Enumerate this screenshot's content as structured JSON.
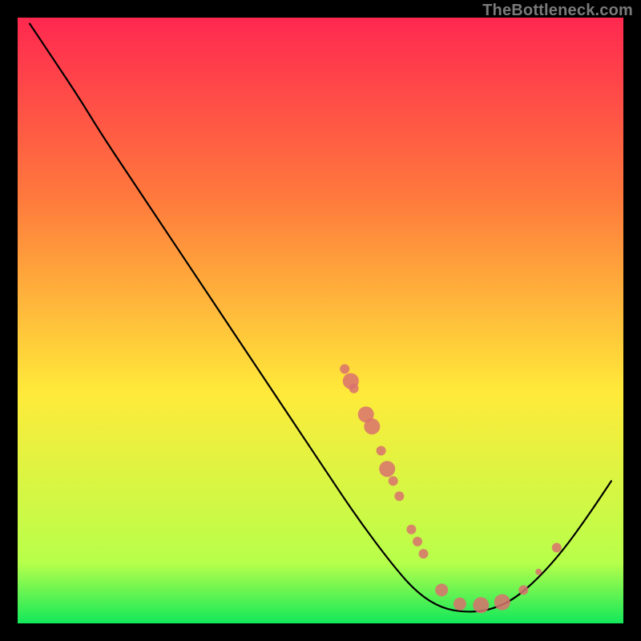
{
  "watermark": "TheBottleneck.com",
  "chart_data": {
    "type": "line",
    "title": "",
    "xlabel": "",
    "ylabel": "",
    "xlim": [
      0,
      100
    ],
    "ylim": [
      0,
      100
    ],
    "grid": false,
    "legend": false,
    "background_gradient": {
      "top": "#ff2850",
      "mid": "#ffea3a",
      "bottom": "#12e85a"
    },
    "series": [
      {
        "name": "curve",
        "type": "line",
        "color": "#000000",
        "points": [
          {
            "x": 2.0,
            "y": 99.0
          },
          {
            "x": 6.0,
            "y": 93.0
          },
          {
            "x": 10.0,
            "y": 87.0
          },
          {
            "x": 14.0,
            "y": 80.5
          },
          {
            "x": 20.0,
            "y": 71.5
          },
          {
            "x": 30.0,
            "y": 56.5
          },
          {
            "x": 40.0,
            "y": 41.5
          },
          {
            "x": 50.0,
            "y": 26.5
          },
          {
            "x": 56.0,
            "y": 17.5
          },
          {
            "x": 62.0,
            "y": 9.5
          },
          {
            "x": 66.0,
            "y": 5.0
          },
          {
            "x": 70.0,
            "y": 2.5
          },
          {
            "x": 74.0,
            "y": 1.8
          },
          {
            "x": 78.0,
            "y": 2.2
          },
          {
            "x": 82.0,
            "y": 4.0
          },
          {
            "x": 86.0,
            "y": 7.5
          },
          {
            "x": 90.0,
            "y": 12.0
          },
          {
            "x": 94.0,
            "y": 17.5
          },
          {
            "x": 98.0,
            "y": 23.5
          }
        ]
      },
      {
        "name": "markers",
        "type": "scatter",
        "color": "#d9716e",
        "points": [
          {
            "x": 54.0,
            "y": 42.0,
            "r": 6
          },
          {
            "x": 55.0,
            "y": 40.0,
            "r": 10
          },
          {
            "x": 55.5,
            "y": 38.8,
            "r": 6
          },
          {
            "x": 57.5,
            "y": 34.5,
            "r": 10
          },
          {
            "x": 58.5,
            "y": 32.5,
            "r": 10
          },
          {
            "x": 60.0,
            "y": 28.5,
            "r": 6
          },
          {
            "x": 61.0,
            "y": 25.5,
            "r": 10
          },
          {
            "x": 62.0,
            "y": 23.5,
            "r": 6
          },
          {
            "x": 63.0,
            "y": 21.0,
            "r": 6
          },
          {
            "x": 65.0,
            "y": 15.5,
            "r": 6
          },
          {
            "x": 66.0,
            "y": 13.5,
            "r": 6
          },
          {
            "x": 67.0,
            "y": 11.5,
            "r": 6
          },
          {
            "x": 70.0,
            "y": 5.5,
            "r": 8
          },
          {
            "x": 73.0,
            "y": 3.2,
            "r": 8
          },
          {
            "x": 76.5,
            "y": 3.0,
            "r": 10
          },
          {
            "x": 80.0,
            "y": 3.5,
            "r": 10
          },
          {
            "x": 83.5,
            "y": 5.5,
            "r": 6
          },
          {
            "x": 86.0,
            "y": 8.5,
            "r": 4
          },
          {
            "x": 89.0,
            "y": 12.5,
            "r": 6
          }
        ]
      }
    ]
  }
}
